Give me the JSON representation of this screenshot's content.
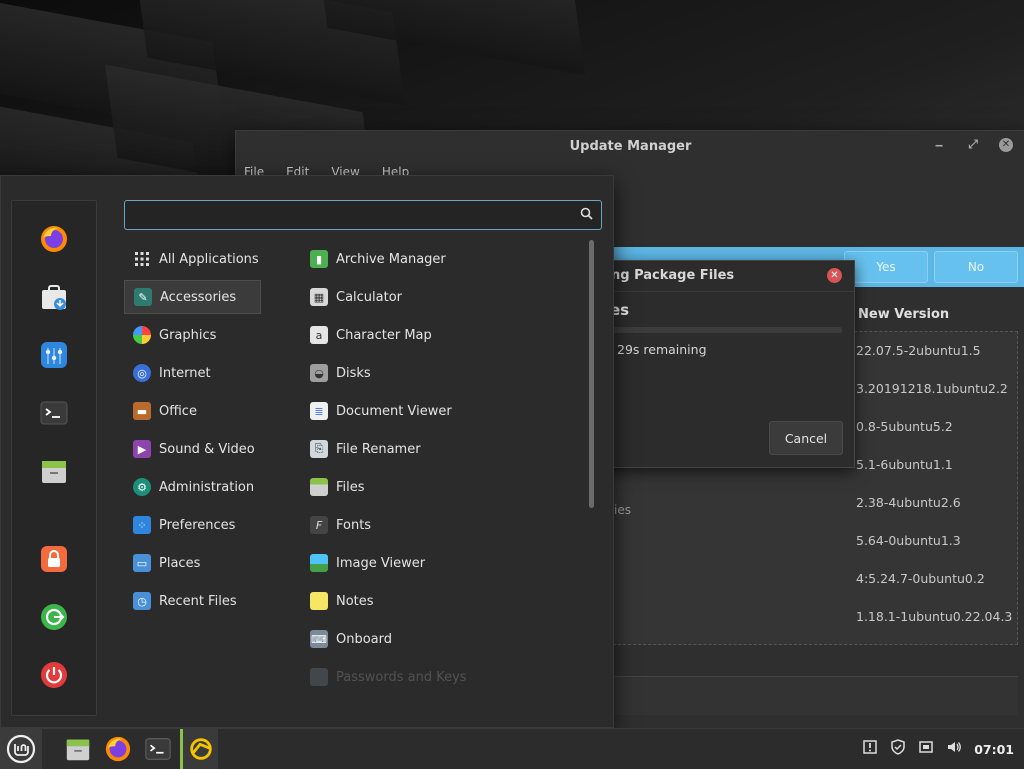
{
  "update_manager": {
    "title": "Update Manager",
    "menu": [
      "File",
      "Edit",
      "View",
      "Help"
    ],
    "yes_label": "Yes",
    "no_label": "No",
    "column_header": "New Version",
    "partial_text": "ities",
    "versions": [
      "22.07.5-2ubuntu1.5",
      "3.20191218.1ubuntu2.2",
      "0.8-5ubuntu5.2",
      "5.1-6ubuntu1.1",
      "2.38-4ubuntu2.6",
      "5.64-0ubuntu1.3",
      "4:5.24.7-0ubuntu0.2",
      "1.18.1-1ubuntu0.22.04.3"
    ]
  },
  "dialog": {
    "title": "ng Package Files",
    "heading": "es",
    "remaining": "29s remaining",
    "cancel_label": "Cancel",
    "progress": 0
  },
  "menu": {
    "search": {
      "value": "",
      "placeholder": ""
    },
    "favorites": [
      "firefox-icon",
      "software-manager-icon",
      "control-center-icon",
      "terminal-icon",
      "files-icon",
      "lock-screen-icon",
      "logout-icon",
      "power-icon"
    ],
    "categories": [
      {
        "label": "All Applications",
        "icon": "grid-icon"
      },
      {
        "label": "Accessories",
        "icon": "accessories-icon"
      },
      {
        "label": "Graphics",
        "icon": "graphics-icon"
      },
      {
        "label": "Internet",
        "icon": "internet-icon"
      },
      {
        "label": "Office",
        "icon": "office-icon"
      },
      {
        "label": "Sound & Video",
        "icon": "sound-video-icon"
      },
      {
        "label": "Administration",
        "icon": "administration-icon"
      },
      {
        "label": "Preferences",
        "icon": "preferences-icon"
      },
      {
        "label": "Places",
        "icon": "places-icon"
      },
      {
        "label": "Recent Files",
        "icon": "recent-files-icon"
      }
    ],
    "apps": [
      {
        "label": "Archive Manager",
        "icon": "archive-icon"
      },
      {
        "label": "Calculator",
        "icon": "calculator-icon"
      },
      {
        "label": "Character Map",
        "icon": "character-map-icon"
      },
      {
        "label": "Disks",
        "icon": "disks-icon"
      },
      {
        "label": "Document Viewer",
        "icon": "document-viewer-icon"
      },
      {
        "label": "File Renamer",
        "icon": "file-renamer-icon"
      },
      {
        "label": "Files",
        "icon": "files-icon"
      },
      {
        "label": "Fonts",
        "icon": "fonts-icon"
      },
      {
        "label": "Image Viewer",
        "icon": "image-viewer-icon"
      },
      {
        "label": "Notes",
        "icon": "notes-icon"
      },
      {
        "label": "Onboard",
        "icon": "onboard-icon"
      }
    ],
    "faded_item": "Passwords and Keys"
  },
  "panel": {
    "clock": "07:01",
    "launchers": [
      "mint-menu-icon",
      "files-icon",
      "firefox-icon",
      "terminal-icon",
      "update-manager-icon"
    ],
    "tray": [
      "update-notice-icon",
      "shield-icon",
      "network-icon",
      "volume-icon"
    ]
  },
  "colors": {
    "accent": "#5db7e6",
    "panel": "#2c2c2c",
    "menu_bg": "#2b2b2b",
    "close_red": "#d65454"
  }
}
